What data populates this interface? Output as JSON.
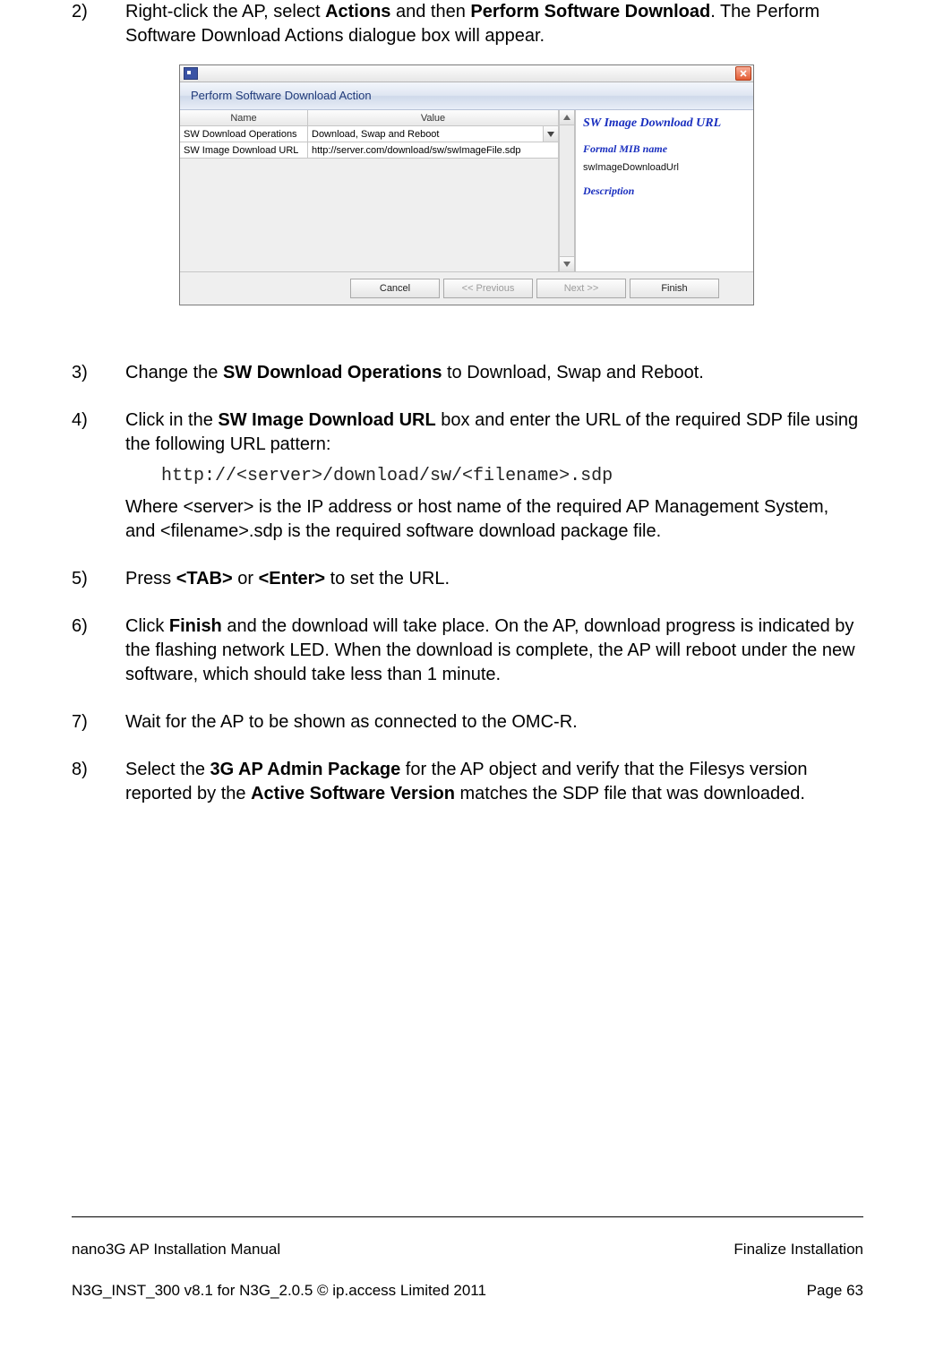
{
  "steps": {
    "s2": {
      "num": "2)",
      "pre": "Right-click the AP, select ",
      "b1": "Actions",
      "mid": " and then ",
      "b2": "Perform Software Download",
      "post": ". The Perform Software Download Actions dialogue box will appear."
    },
    "s3": {
      "num": "3)",
      "pre": "Change the ",
      "b1": "SW Download Operations",
      "post": " to Download, Swap and Reboot."
    },
    "s4": {
      "num": "4)",
      "pre": "Click in the ",
      "b1": "SW Image Download URL",
      "post": " box and enter the URL of the required SDP file using the following URL pattern:",
      "code": "http://<server>/download/sw/<filename>.sdp",
      "sub": "Where <server> is the IP address or host name of the required AP Management System, and <filename>.sdp is the required software download package file."
    },
    "s5": {
      "num": "5)",
      "pre": "Press ",
      "b1": "<TAB>",
      "mid": " or ",
      "b2": "<Enter>",
      "post": " to set the URL."
    },
    "s6": {
      "num": "6)",
      "pre": "Click ",
      "b1": "Finish",
      "post": " and the download will take place. On the AP, download progress is indicated by the flashing network LED. When the download is complete, the AP will reboot under the new software, which should take less than 1 minute."
    },
    "s7": {
      "num": "7)",
      "text": "Wait for the AP to be shown as connected to the OMC-R."
    },
    "s8": {
      "num": "8)",
      "pre": "Select the ",
      "b1": "3G AP Admin Package",
      "mid": " for the AP object and verify that the Filesys version reported by the ",
      "b2": "Active Software Version",
      "post": " matches the SDP file that was downloaded."
    }
  },
  "dialog": {
    "title": "Perform Software Download Action",
    "headers": {
      "name": "Name",
      "value": "Value"
    },
    "rows": [
      {
        "name": "SW Download Operations",
        "value": "Download, Swap and Reboot",
        "dropdown": true
      },
      {
        "name": "SW Image Download URL",
        "value": "http://server.com/download/sw/swImageFile.sdp",
        "dropdown": false
      }
    ],
    "side": {
      "heading": "SW Image Download URL",
      "formal_label": "Formal MIB name",
      "formal_value": "swImageDownloadUrl",
      "desc_label": "Description"
    },
    "buttons": {
      "cancel": "Cancel",
      "prev": "<< Previous",
      "next": "Next >>",
      "finish": "Finish"
    }
  },
  "footer": {
    "left1": "nano3G AP Installation Manual",
    "left2": "N3G_INST_300 v8.1 for N3G_2.0.5 © ip.access Limited 2011",
    "right1": "Finalize Installation",
    "right2": "Page 63"
  }
}
